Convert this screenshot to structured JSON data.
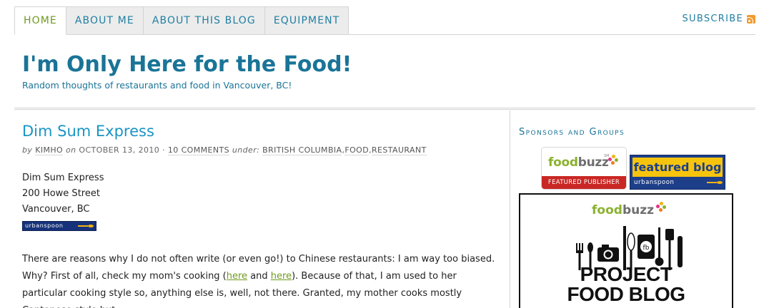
{
  "nav": {
    "tabs": [
      {
        "label": "HOME",
        "active": true
      },
      {
        "label": "ABOUT ME",
        "active": false
      },
      {
        "label": "ABOUT THIS BLOG",
        "active": false
      },
      {
        "label": "EQUIPMENT",
        "active": false
      }
    ],
    "subscribe_label": "SUBSCRIBE",
    "subscribe_icon": "rss-icon"
  },
  "header": {
    "title": "I'm Only Here for the Food!",
    "tagline": "Random thoughts of restaurants and food in Vancouver, BC!"
  },
  "post": {
    "title": "Dim Sum Express",
    "byline": {
      "by": "by",
      "author": "KIMHO",
      "on": "on",
      "date": "OCTOBER 13, 2010",
      "sep": "·",
      "comments": "10 COMMENTS",
      "under": "under:",
      "categories": [
        "BRITISH COLUMBIA",
        "FOOD",
        "RESTAURANT"
      ]
    },
    "address": [
      "Dim Sum Express",
      "200 Howe Street",
      "Vancouver, BC"
    ],
    "urbanspoon_badge": "urbanspoon",
    "body": {
      "p1_a": "There are reasons why I do not often write (or even go!) to Chinese restaurants: I am way too biased. Why? First of all, check my mom's cooking (",
      "link1": "here",
      "p1_b": " and ",
      "link2": "here",
      "p1_c": "). Because of that, I am used to her particular cooking style so, anything else is, well, not there. Granted, my mother cooks mostly Cantonese style but"
    }
  },
  "sidebar": {
    "heading": "Sponsors and Groups",
    "foodbuzz_badge": {
      "word_a": "food",
      "word_b": "buzz",
      "sm": "SM",
      "band": "FEATURED PUBLISHER"
    },
    "featured_blog": {
      "title": "featured blog",
      "sub": "urbanspoon"
    },
    "project_food_blog": {
      "logo_a": "food",
      "logo_b": "buzz",
      "fb_mark": "fb",
      "line1": "PROJECT",
      "line2": "FOOD BLOG"
    }
  },
  "colors": {
    "link": "#1f7fa3",
    "title": "#1a7497",
    "post_title": "#1a94c4",
    "active_tab": "#6f9a1f",
    "urbanspoon": "#16327a",
    "foodbuzz_green": "#8bb12e",
    "featured_red": "#c92724"
  }
}
